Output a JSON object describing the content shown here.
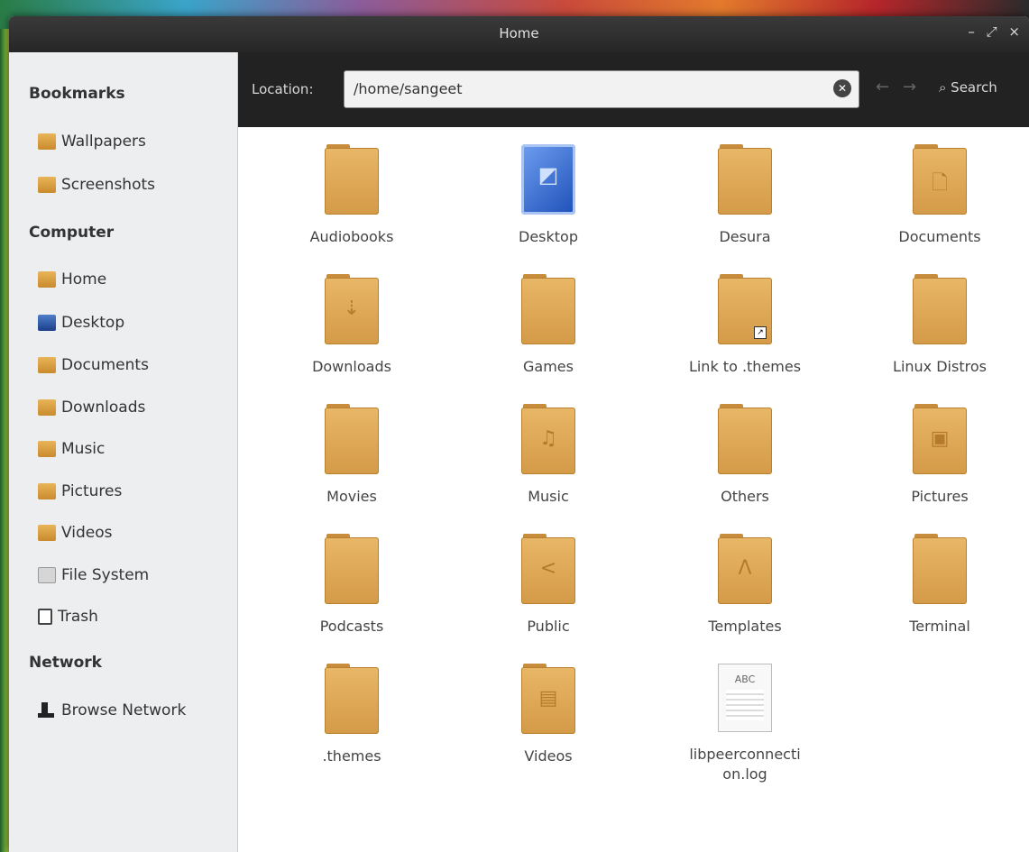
{
  "window": {
    "title": "Home",
    "controls": "– ⤢ ×"
  },
  "toolbar": {
    "location_label": "Location:",
    "location_value": "/home/sangeet",
    "back": "←",
    "forward": "→",
    "search_label": "Search"
  },
  "sidebar": {
    "bookmarks_heading": "Bookmarks",
    "bookmarks": [
      "Wallpapers",
      "Screenshots"
    ],
    "computer_heading": "Computer",
    "computer": [
      "Home",
      "Desktop",
      "Documents",
      "Downloads",
      "Music",
      "Pictures",
      "Videos",
      "File System",
      "Trash"
    ],
    "network_heading": "Network",
    "network": [
      "Browse Network"
    ]
  },
  "files": [
    {
      "name": "Audiobooks",
      "icon": "folder-icon"
    },
    {
      "name": "Desktop",
      "icon": "desktop-icon"
    },
    {
      "name": "Desura",
      "icon": "folder-icon"
    },
    {
      "name": "Documents",
      "icon": "documents-folder-icon"
    },
    {
      "name": "Downloads",
      "icon": "downloads-folder-icon"
    },
    {
      "name": "Games",
      "icon": "folder-icon"
    },
    {
      "name": "Link to .themes",
      "icon": "folder-link-icon"
    },
    {
      "name": "Linux Distros",
      "icon": "folder-icon"
    },
    {
      "name": "Movies",
      "icon": "folder-icon"
    },
    {
      "name": "Music",
      "icon": "music-folder-icon"
    },
    {
      "name": "Others",
      "icon": "folder-icon"
    },
    {
      "name": "Pictures",
      "icon": "pictures-folder-icon"
    },
    {
      "name": "Podcasts",
      "icon": "folder-icon"
    },
    {
      "name": "Public",
      "icon": "public-folder-icon"
    },
    {
      "name": "Templates",
      "icon": "templates-folder-icon"
    },
    {
      "name": "Terminal",
      "icon": "folder-icon"
    },
    {
      "name": ".themes",
      "icon": "folder-icon"
    },
    {
      "name": "Videos",
      "icon": "videos-folder-icon"
    },
    {
      "name": "libpeerconnection.log",
      "icon": "text-file-icon",
      "badge": "ABC"
    }
  ]
}
